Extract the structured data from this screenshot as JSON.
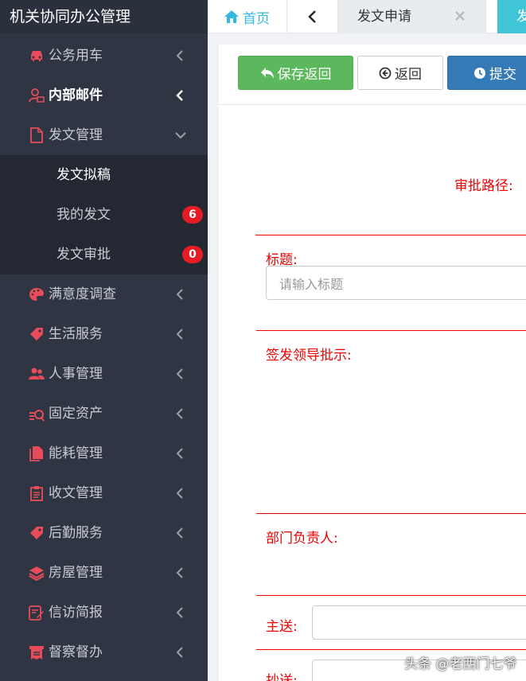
{
  "app": {
    "title": "机关协同办公管理"
  },
  "sidebar": {
    "items": [
      {
        "label": "公务用车",
        "icon": "car-icon"
      },
      {
        "label": "内部邮件",
        "icon": "mail-user-icon"
      },
      {
        "label": "发文管理",
        "icon": "file-icon"
      },
      {
        "label": "满意度调查",
        "icon": "palette-icon"
      },
      {
        "label": "生活服务",
        "icon": "tag-icon"
      },
      {
        "label": "人事管理",
        "icon": "users-icon"
      },
      {
        "label": "固定资产",
        "icon": "asset-search-icon"
      },
      {
        "label": "能耗管理",
        "icon": "files-icon"
      },
      {
        "label": "收文管理",
        "icon": "clipboard-icon"
      },
      {
        "label": "后勤服务",
        "icon": "tag-icon"
      },
      {
        "label": "房屋管理",
        "icon": "layers-icon"
      },
      {
        "label": "信访简报",
        "icon": "edit-doc-icon"
      },
      {
        "label": "督察督办",
        "icon": "receipt-icon"
      }
    ],
    "submenu": [
      {
        "label": "发文拟稿"
      },
      {
        "label": "我的发文",
        "badge": "6"
      },
      {
        "label": "发文审批",
        "badge": "0"
      }
    ]
  },
  "tabs": {
    "home": "首页",
    "current": "发文申请",
    "next": "发"
  },
  "toolbar": {
    "save": "保存返回",
    "back": "返回",
    "submit": "提交"
  },
  "form": {
    "route_label": "审批路径:",
    "title_label": "标题:",
    "title_placeholder": "请输入标题",
    "leader_label": "签发领导批示:",
    "dept_label": "部门负责人:",
    "to_label": "主送:",
    "cc_label": "抄送:"
  },
  "watermark": "头条 @老西门七爷",
  "colors": {
    "sidebar_bg": "#2f3542",
    "accent_green": "#5cb85c",
    "accent_blue": "#337ab7",
    "badge_red": "#e51c23",
    "form_red": "#e00"
  }
}
